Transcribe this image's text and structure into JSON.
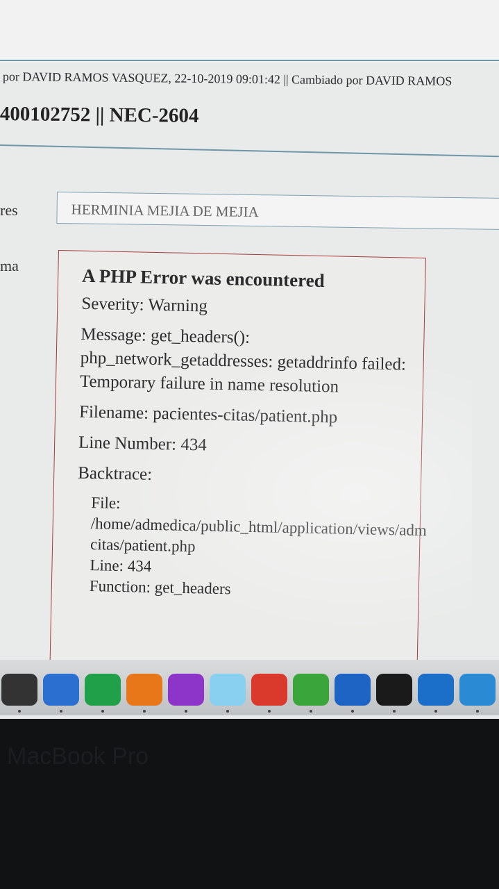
{
  "header": {
    "meta_line": "por DAVID RAMOS VASQUEZ, 22-10-2019 09:01:42 || Cambiado por DAVID RAMOS",
    "record_title": "400102752 || NEC-2604"
  },
  "form": {
    "label_res": "res",
    "label_ma": "ma",
    "name_value": "HERMINIA MEJIA DE MEJIA"
  },
  "error": {
    "heading": "A PHP Error was encountered",
    "severity": "Severity: Warning",
    "message": "Message: get_headers(): php_network_getaddresses: getaddrinfo failed: Temporary failure in name resolution",
    "filename": "Filename: pacientes-citas/patient.php",
    "line_number": "Line Number: 434",
    "backtrace_label": "Backtrace:",
    "trace": {
      "file_label": "File:",
      "file_path": "/home/admedica/public_html/application/views/adm",
      "file_path_2": "citas/patient.php",
      "line": "Line: 434",
      "function": "Function: get_headers"
    }
  },
  "dock": {
    "icons": [
      "finder-icon",
      "word-icon",
      "excel-icon",
      "powerpoint-icon",
      "ie-icon",
      "skype-icon",
      "presentation-icon",
      "utorrent-icon",
      "network-icon",
      "terminal-icon",
      "teamviewer-icon",
      "globe-icon"
    ],
    "colors": [
      "#333333",
      "#2b6fd1",
      "#21a04a",
      "#e8771a",
      "#8e35c9",
      "#88cff0",
      "#d93a2b",
      "#3aa53a",
      "#1d64c4",
      "#1a1a1a",
      "#1c6fc8",
      "#2a8bd4"
    ]
  },
  "bezel": {
    "label": "MacBook Pro"
  }
}
